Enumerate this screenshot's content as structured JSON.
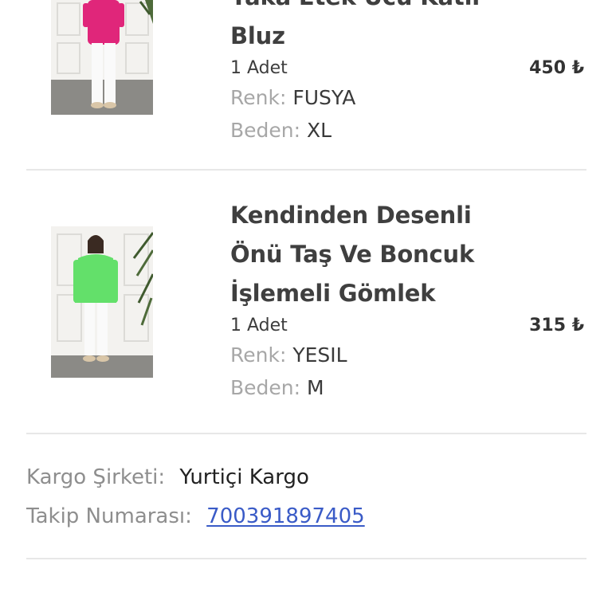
{
  "items": [
    {
      "title_lines": [
        "Yaka Etek Ucu Katlı",
        "Bluz"
      ],
      "quantity": "1 Adet",
      "price": "450 ₺",
      "color_label": "Renk:",
      "color_value": "FUSYA",
      "size_label": "Beden:",
      "size_value": "XL",
      "garment_color": "#e0267a"
    },
    {
      "title_lines": [
        "Kendinden Desenli",
        "Önü Taş Ve Boncuk",
        "İşlemeli Gömlek"
      ],
      "quantity": "1 Adet",
      "price": "315 ₺",
      "color_label": "Renk:",
      "color_value": "YESIL",
      "size_label": "Beden:",
      "size_value": "M",
      "garment_color": "#63e06a"
    }
  ],
  "shipping": {
    "carrier_label": "Kargo Şirketi:",
    "carrier_value": "Yurtiçi Kargo",
    "tracking_label": "Takip Numarası:",
    "tracking_value": "700391897405",
    "link_color": "#3a5bc7"
  }
}
